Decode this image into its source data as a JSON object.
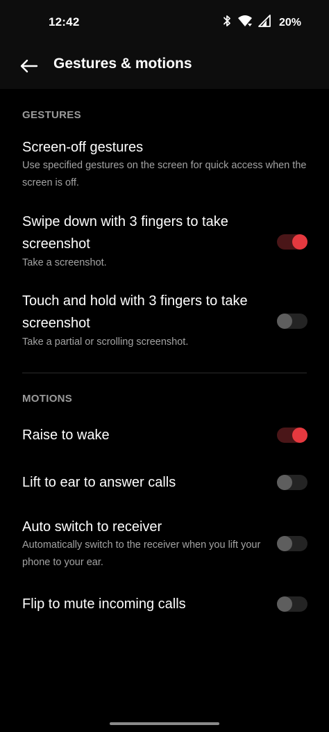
{
  "status_bar": {
    "time": "12:42",
    "battery": "20%",
    "icons": [
      "bluetooth-icon",
      "wifi-icon",
      "signal-icon"
    ]
  },
  "app_bar": {
    "title": "Gestures & motions",
    "back_icon": "arrow-left-icon"
  },
  "gestures": {
    "header": "GESTURES",
    "items": [
      {
        "title": "Screen-off gestures",
        "subtitle": "Use specified gestures on the screen for quick access when the screen is off."
      },
      {
        "title": "Swipe down with 3 fingers to take screenshot",
        "subtitle": "Take a screenshot.",
        "toggle": "on"
      },
      {
        "title": "Touch and hold with 3 fingers to take screenshot",
        "subtitle": "Take a partial or scrolling screenshot.",
        "toggle": "off"
      }
    ]
  },
  "motions": {
    "header": "MOTIONS",
    "items": [
      {
        "title": "Raise to wake",
        "toggle": "on"
      },
      {
        "title": "Lift to ear to answer calls",
        "toggle": "off"
      },
      {
        "title": "Auto switch to receiver",
        "subtitle": "Automatically switch to the receiver when you lift your phone to your ear.",
        "toggle": "off"
      },
      {
        "title": "Flip to mute incoming calls",
        "toggle": "off"
      }
    ]
  },
  "colors": {
    "accent": "#e5393f",
    "background": "#000000",
    "bar_background": "#0d0d0d",
    "secondary_text": "#a3a3a3",
    "section_header": "#9b9b9b"
  }
}
